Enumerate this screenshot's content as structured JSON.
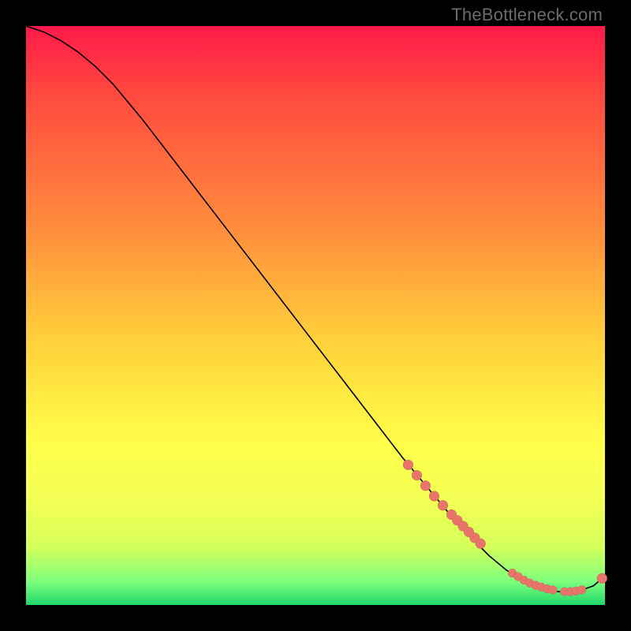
{
  "watermark": "TheBottleneck.com",
  "palette": {
    "bg_black": "#000000",
    "grad_top": "#ff1a4a",
    "grad_mid1": "#ff8a3d",
    "grad_mid2": "#ffd23a",
    "grad_mid3": "#ffff4a",
    "grad_low1": "#d4ff5a",
    "grad_low2": "#7dff7d",
    "grad_bottom": "#1fd86b",
    "curve_stroke": "#000000",
    "dot_fill": "#e8756a"
  },
  "chart_data": {
    "type": "line",
    "title": "",
    "xlabel": "",
    "ylabel": "",
    "xlim": [
      0,
      100
    ],
    "ylim": [
      0,
      100
    ],
    "series": [
      {
        "name": "curve",
        "x": [
          0,
          3,
          6,
          9,
          12,
          15,
          20,
          25,
          30,
          35,
          40,
          45,
          50,
          55,
          60,
          65,
          70,
          75,
          80,
          83,
          86,
          88,
          90,
          92,
          94,
          96,
          98,
          100
        ],
        "y": [
          100,
          99,
          97.5,
          95.5,
          93,
          90,
          84,
          77.5,
          71,
          64.5,
          58,
          51.5,
          45,
          38.5,
          32,
          25.5,
          19.5,
          13.5,
          8.5,
          6,
          4.2,
          3.2,
          2.6,
          2.3,
          2.3,
          2.6,
          3.3,
          5
        ]
      }
    ],
    "markers": {
      "name": "highlighted-points",
      "x": [
        66,
        67.5,
        69,
        70.5,
        72,
        73.5,
        74.5,
        75.5,
        76.5,
        77.5,
        78.5,
        84,
        85,
        86,
        87,
        88,
        89,
        90,
        91,
        93,
        94,
        95,
        96,
        99.5
      ],
      "y": [
        24.2,
        22.4,
        20.6,
        18.8,
        17.2,
        15.6,
        14.6,
        13.6,
        12.6,
        11.6,
        10.6,
        5.5,
        4.9,
        4.3,
        3.8,
        3.4,
        3.1,
        2.8,
        2.6,
        2.3,
        2.3,
        2.4,
        2.6,
        4.6
      ],
      "r": [
        6.5,
        6.5,
        6.5,
        6.5,
        6.5,
        6.5,
        6.5,
        6.5,
        6.5,
        6.5,
        6.5,
        5.5,
        5.5,
        5.5,
        5.5,
        5.5,
        5.5,
        5.5,
        5.5,
        5.5,
        5.5,
        5.5,
        5.5,
        6.5
      ]
    }
  }
}
